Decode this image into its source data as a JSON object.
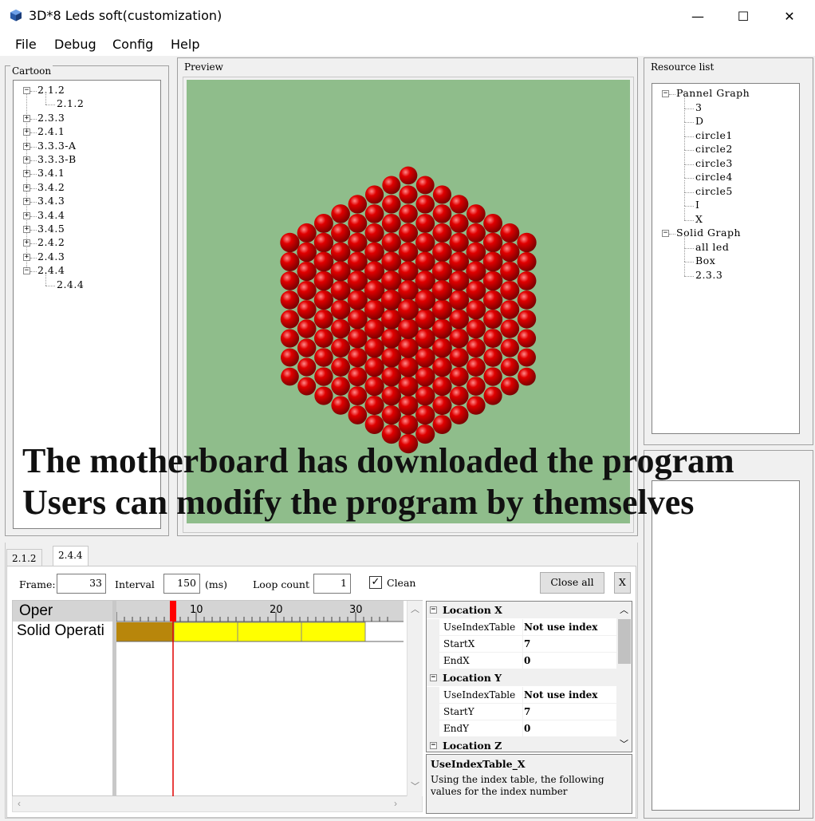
{
  "window": {
    "title": "3D*8 Leds soft(customization)",
    "minimize": "—",
    "maximize": "☐",
    "close": "✕"
  },
  "menu": [
    "File",
    "Debug",
    "Config",
    "Help"
  ],
  "cartoon": {
    "title": "Cartoon",
    "items": [
      {
        "label": "2.1.2",
        "expanded": true,
        "children": [
          "2.1.2"
        ]
      },
      {
        "label": "2.3.3"
      },
      {
        "label": "2.4.1"
      },
      {
        "label": "3.3.3-A"
      },
      {
        "label": "3.3.3-B"
      },
      {
        "label": "3.4.1"
      },
      {
        "label": "3.4.2"
      },
      {
        "label": "3.4.3"
      },
      {
        "label": "3.4.4"
      },
      {
        "label": "3.4.5"
      },
      {
        "label": "2.4.2"
      },
      {
        "label": "2.4.3"
      },
      {
        "label": "2.4.4",
        "expanded": true,
        "children": [
          "2.4.4"
        ]
      }
    ]
  },
  "preview": {
    "title": "Preview",
    "led_color": "#e00000",
    "background": "#8fbd8b"
  },
  "overlay": {
    "line1": "The motherboard has downloaded the program",
    "line2": "Users can modify the program by themselves"
  },
  "resources": {
    "title": "Resource list",
    "groups": [
      {
        "label": "Pannel Graph",
        "children": [
          "3",
          "D",
          "circle1",
          "circle2",
          "circle3",
          "circle4",
          "circle5",
          "I",
          "X"
        ]
      },
      {
        "label": "Solid Graph",
        "children": [
          "all led",
          "Box",
          "2.3.3"
        ]
      }
    ]
  },
  "tabs": [
    "2.1.2",
    "2.4.4"
  ],
  "controls": {
    "frame_label": "Frame:",
    "frame_value": "33",
    "interval_label": "Interval",
    "interval_value": "150",
    "interval_unit": "(ms)",
    "loop_label": "Loop count",
    "loop_value": "1",
    "clean_label": "Clean",
    "clean_checked": true,
    "close_all": "Close all",
    "close_x": "X"
  },
  "timeline": {
    "header": "Oper",
    "row": "Solid Operati",
    "ticks": [
      "10",
      "20",
      "30"
    ],
    "cursor_frame": 7
  },
  "properties": {
    "categories": [
      {
        "name": "Location X",
        "rows": [
          [
            "UseIndexTable",
            "Not use index"
          ],
          [
            "StartX",
            "7"
          ],
          [
            "EndX",
            "0"
          ]
        ]
      },
      {
        "name": "Location Y",
        "rows": [
          [
            "UseIndexTable",
            "Not use index"
          ],
          [
            "StartY",
            "7"
          ],
          [
            "EndY",
            "0"
          ]
        ]
      },
      {
        "name": "Location Z",
        "rows": []
      }
    ],
    "help_title": "UseIndexTable_X",
    "help_text": "Using the index table, the following values for the index number"
  }
}
